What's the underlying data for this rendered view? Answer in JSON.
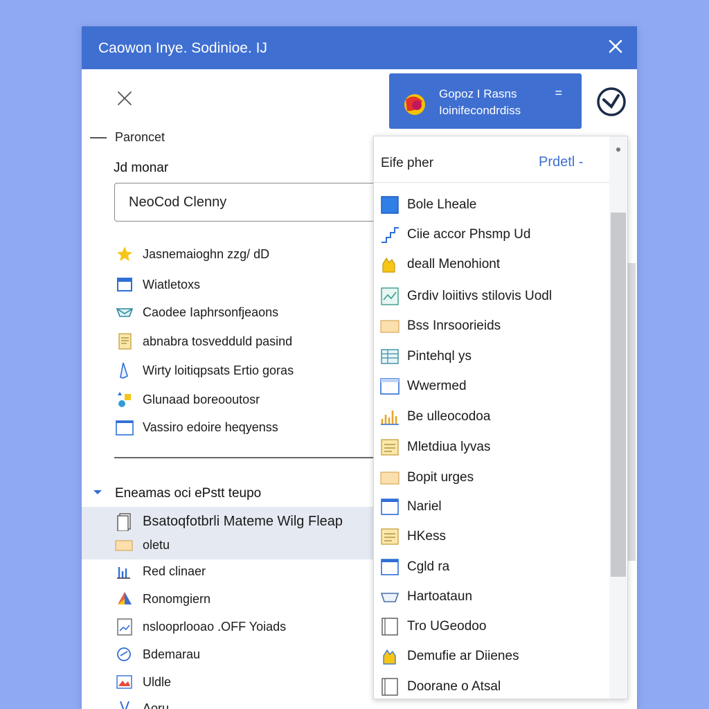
{
  "window": {
    "title": "Caowon Inye. Sodinioe. IJ"
  },
  "account": {
    "line1": "Gopoz I Rasns",
    "line2": "Ioinifecondrdiss",
    "menu_glyph": "="
  },
  "section": {
    "title": "Paroncet"
  },
  "field": {
    "label": "Jd monar",
    "value": "NeoCod Clenny"
  },
  "left_items": [
    {
      "label": "Jasnemaioghn zzg/ dD",
      "icon": "star-icon"
    },
    {
      "label": "Wiatletoxs",
      "icon": "window-icon"
    },
    {
      "label": "Caodee Iaphrsonfjeaons",
      "icon": "envelope-icon"
    },
    {
      "label": "abnabra tosvedduld pasind",
      "icon": "note-icon"
    },
    {
      "label": "Wirty loitiqpsats Ertio goras",
      "icon": "pen-icon"
    },
    {
      "label": "Glunaad boreooutosr",
      "icon": "shapes-icon"
    },
    {
      "label": "Vassiro edoire heqyenss",
      "icon": "window-icon"
    }
  ],
  "section2": {
    "title": "Eneamas oci ePstt teupo",
    "items": [
      {
        "label": "Bsatoqfotbrli Mateme Wilg Fleap",
        "icon": "document-icon"
      },
      {
        "label": "oletu",
        "icon": "folder-icon"
      },
      {
        "label": "Red clinaer",
        "icon": "bar-chart-icon"
      },
      {
        "label": "Ronomgiern",
        "icon": "triangle-logo-icon"
      },
      {
        "label": "nslooprlooao .OFF Yoiads",
        "icon": "chart-doc-icon"
      },
      {
        "label": "Bdemarau",
        "icon": "link-icon"
      },
      {
        "label": "Uldle",
        "icon": "image-icon"
      },
      {
        "label": "Aoru",
        "icon": "pen-icon"
      }
    ]
  },
  "dropdown": {
    "title": "Eife pher",
    "action": "Prdetl -",
    "items": [
      {
        "label": "Bole Lheale",
        "icon": "square-blue-icon"
      },
      {
        "label": "Ciie accor Phsmp Ud",
        "icon": "stairs-icon"
      },
      {
        "label": "deall Menohiont",
        "icon": "hand-icon"
      },
      {
        "label": "Grdiv loiitivs stilovis Uodl",
        "icon": "chart-doc-icon"
      },
      {
        "label": "Bss Inrsoorieids",
        "icon": "folder-icon"
      },
      {
        "label": "Pintehql ys",
        "icon": "table-icon"
      },
      {
        "label": "Wwermed",
        "icon": "window-icon"
      },
      {
        "label": "Be ulleocodoa",
        "icon": "bar-chart-icon"
      },
      {
        "label": "Mletdiua lyvas",
        "icon": "note-icon"
      },
      {
        "label": "Bopit urges",
        "icon": "folder-icon"
      },
      {
        "label": "Nariel",
        "icon": "window-icon"
      },
      {
        "label": "HKess",
        "icon": "note-icon"
      },
      {
        "label": "Cgld ra",
        "icon": "window-icon"
      },
      {
        "label": "Hartoataun",
        "icon": "envelope-icon"
      },
      {
        "label": "Tro UGeodoo",
        "icon": "document-icon"
      },
      {
        "label": "Demufie ar Diienes",
        "icon": "hand-icon"
      },
      {
        "label": "Doorane o Atsal",
        "icon": "document-icon"
      }
    ]
  }
}
